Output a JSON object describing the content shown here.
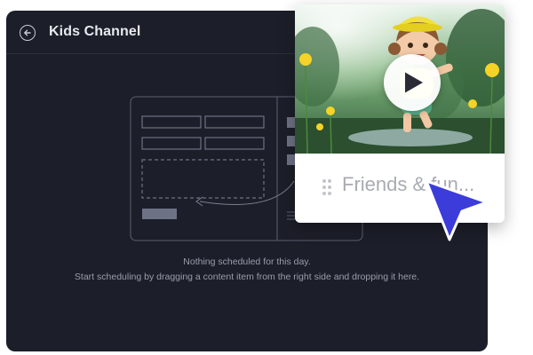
{
  "window": {
    "title": "Kids Channel"
  },
  "empty_state": {
    "line1": "Nothing scheduled for this day.",
    "line2": "Start scheduling by dragging a content item from the right side and dropping it here."
  },
  "content_card": {
    "title": "Friends & fun..."
  },
  "icons": {
    "back": "back-arrow-icon",
    "play": "play-icon",
    "drag": "drag-handle-icon",
    "cursor": "pointer-cursor-icon"
  },
  "colors": {
    "panel_bg": "#1c1e29",
    "cursor": "#3b3cd9",
    "illustration_stroke": "#5b6070",
    "illustration_fill": "#6d7284"
  }
}
